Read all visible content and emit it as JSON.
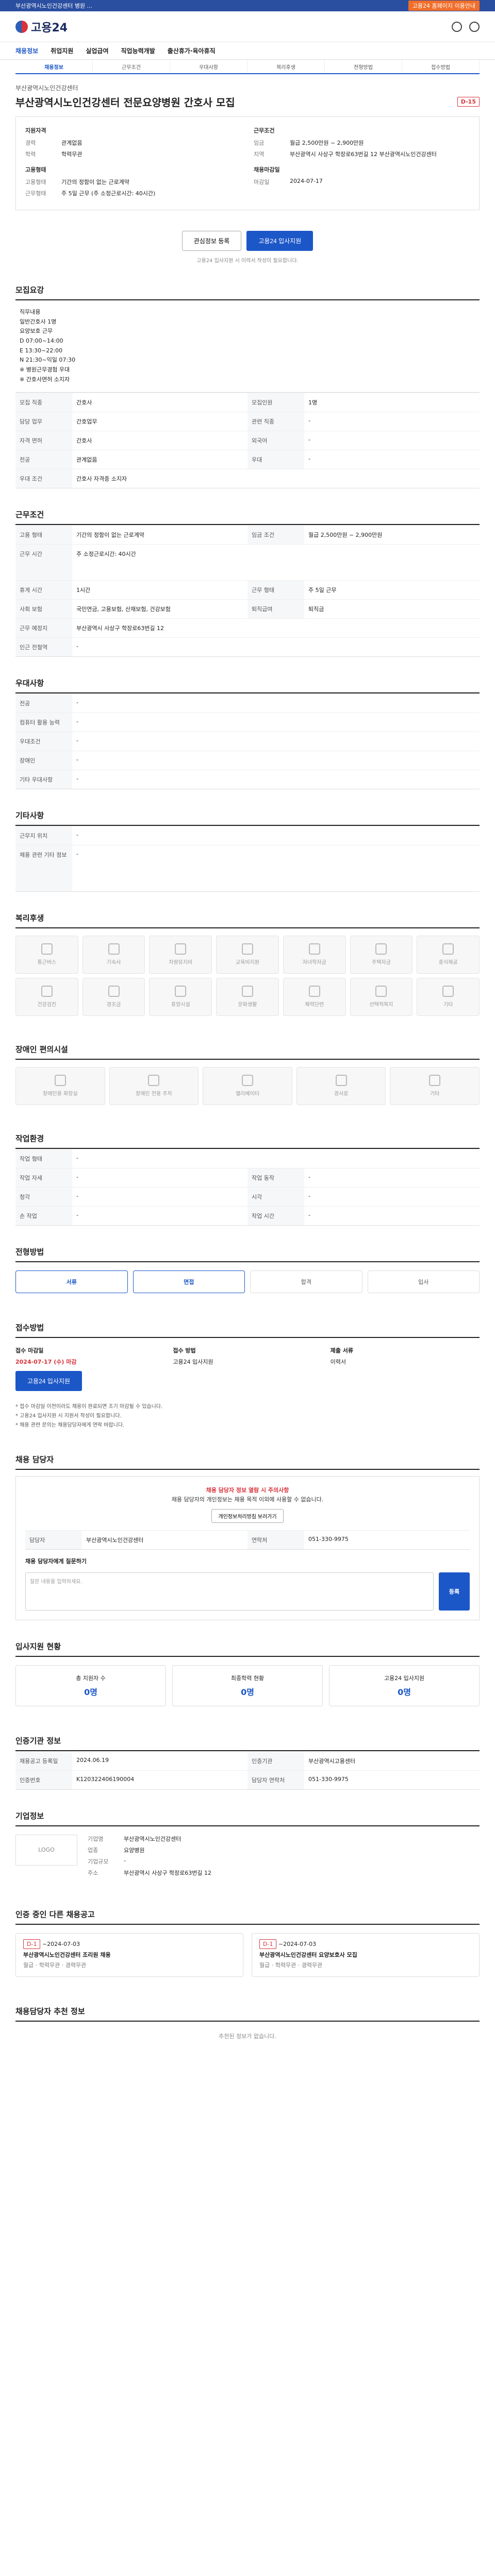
{
  "topbar": {
    "left": "부산광역시노인건강센터 병원 ...",
    "right": "고용24 홈페이지 이용안내"
  },
  "header": {
    "brand": "고용24"
  },
  "gnb": [
    "채용정보",
    "취업지원",
    "실업급여",
    "직업능력개발",
    "출산휴가·육아휴직"
  ],
  "tabs": [
    "채용정보",
    "근무조건",
    "우대사항",
    "복리후생",
    "전형방법",
    "접수방법"
  ],
  "job": {
    "company": "부산광역시노인건강센터",
    "title": "부산광역시노인건강센터 전문요양병원 간호사 모집",
    "dday": "D-15"
  },
  "summary": {
    "left_title": "지원자격",
    "left": [
      {
        "k": "경력",
        "v": "관계없음"
      },
      {
        "k": "학력",
        "v": "학력무관"
      }
    ],
    "left_title2": "고용형태",
    "left2": [
      {
        "k": "고용형태",
        "v": "기간의 정함이 없는 근로계약"
      },
      {
        "k": "근무형태",
        "v": "주 5일 근무 (주 소정근로시간: 40시간)"
      }
    ],
    "right_title": "근무조건",
    "right": [
      {
        "k": "임금",
        "v": "월급 2,500만원 ~ 2,900만원"
      },
      {
        "k": "지역",
        "v": "부산광역시 사상구 학장로63번길 12 부산광역시노인건강센터"
      }
    ],
    "right_title2": "채용마감일",
    "right2": [
      {
        "k": "마감일",
        "v": "2024-07-17"
      }
    ]
  },
  "buttons": {
    "scrap": "관심정보 등록",
    "apply": "고용24 입사지원"
  },
  "note": "고용24 입사지원 시 이력서 작성이 필요합니다.",
  "sec_recruit": {
    "title": "모집요강",
    "desc": "직무내용\n일반간호사 1명\n요양보호 근무\nD 07:00~14:00\nE 13:30~22:00\nN 21:30~익일 07:30\n※ 병원근무경험 우대\n※ 간호사면허 소지자",
    "rows": [
      [
        "모집 직종",
        "간호사",
        "모집인원",
        "1명"
      ],
      [
        "담당 업무",
        "간호업무",
        "관련 직종",
        "-"
      ],
      [
        "자격 면허",
        "간호사",
        "외국어",
        "-"
      ],
      [
        "전공",
        "관계없음",
        "우대",
        "-"
      ],
      [
        "우대 조건",
        "간호사 자격증 소지자",
        "",
        ""
      ]
    ]
  },
  "sec_work": {
    "title": "근무조건",
    "rows": [
      [
        "고용 형태",
        "기간의 정함이 없는 근로계약",
        "임금 조건",
        "월급 2,500만원 ~ 2,900만원"
      ],
      [
        "근무 시간",
        "주 소정근로시간: 40시간",
        "",
        ""
      ],
      [
        "휴게 시간",
        "1시간",
        "근무 형태",
        "주 5일 근무"
      ],
      [
        "사회 보험",
        "국민연금, 고용보험, 산재보험, 건강보험",
        "퇴직급여",
        "퇴직금"
      ],
      [
        "근무 예정지",
        "부산광역시 사상구 학장로63번길 12",
        "",
        ""
      ],
      [
        "인근 전철역",
        "-",
        "",
        ""
      ]
    ]
  },
  "sec_pref": {
    "title": "우대사항",
    "rows": [
      [
        "전공",
        "-"
      ],
      [
        "컴퓨터 활용 능력",
        "-"
      ],
      [
        "우대조건",
        "-"
      ],
      [
        "장애인",
        "-"
      ],
      [
        "기타 우대사항",
        "-"
      ]
    ]
  },
  "sec_etc": {
    "title": "기타사항",
    "rows": [
      [
        "근무지 위치",
        "-"
      ],
      [
        "채용 관련 기타 정보",
        "-"
      ]
    ]
  },
  "sec_welfare": {
    "title": "복리후생",
    "items": [
      "통근버스",
      "기숙사",
      "차량유지비",
      "교육비지원",
      "자녀학자금",
      "주택자금",
      "중식제공",
      "건강검진",
      "경조금",
      "휴양시설",
      "문화생활",
      "체력단련",
      "선택적복지",
      "기타"
    ]
  },
  "sec_disab": {
    "title": "장애인 편의시설",
    "items": [
      "장애인용 화장실",
      "장애인 전용 주차",
      "엘리베이터",
      "경사로",
      "기타"
    ]
  },
  "sec_env": {
    "title": "작업환경",
    "rows": [
      [
        "작업 형태",
        "-",
        "",
        ""
      ],
      [
        "작업 자세",
        "-",
        "작업 동작",
        "-"
      ],
      [
        "청각",
        "-",
        "시각",
        "-"
      ],
      [
        "손 작업",
        "-",
        "작업 시간",
        "-"
      ]
    ]
  },
  "sec_process": {
    "title": "전형방법",
    "steps": [
      "서류",
      "면접",
      "합격",
      "입사"
    ]
  },
  "sec_apply": {
    "title": "접수방법",
    "deadline_label": "접수 마감일",
    "deadline": "2024-07-17 (수) 마감",
    "method_label": "접수 방법",
    "method": "고용24 입사지원",
    "docs_label": "제출 서류",
    "docs": "이력서",
    "apply_btn": "고용24 입사지원",
    "bullets": [
      "* 접수 마감일 이전이라도 채용이 완료되면 조기 마감될 수 있습니다.",
      "* 고용24 입사지원 시 지원서 작성이 필요합니다.",
      "* 채용 관련 문의는 채용담당자에게 연락 바랍니다."
    ]
  },
  "sec_manager": {
    "title": "채용 담당자",
    "alert1": "채용 담당자 정보 열람 시 주의사항",
    "alert2": "채용 담당자의 개인정보는 채용 목적 이외에 사용할 수 없습니다.",
    "alert_btn": "개인정보처리방침 보러가기",
    "company_label": "부산광역시노인건강센터",
    "name": "담당자",
    "phone_label": "연락처",
    "phone": "051-330-9975",
    "qna_title": "채용 담당자에게 질문하기",
    "qna_placeholder": "질문 내용을 입력하세요.",
    "qna_send": "등록"
  },
  "sec_status": {
    "title": "입사지원 현황",
    "items": [
      {
        "label": "총 지원자 수",
        "value": "0명"
      },
      {
        "label": "최종학력 현황",
        "value": "0명"
      },
      {
        "label": "고용24 입사지원",
        "value": "0명"
      }
    ]
  },
  "sec_info": {
    "title": "인증기관 정보",
    "rows": [
      [
        "채용공고 등록일",
        "2024.06.19",
        "인증기관",
        "부산광역시고용센터"
      ],
      [
        "인증번호",
        "K120322406190004",
        "담당자 연락처",
        "051-330-9975"
      ]
    ]
  },
  "sec_corp": {
    "title": "기업정보",
    "logo": "LOGO",
    "name_label": "기업명",
    "name": "부산광역시노인건강센터",
    "ind_label": "업종",
    "ind": "요양병원",
    "size_label": "기업규모",
    "size": "-",
    "addr_label": "주소",
    "addr": "부산광역시 사상구 학장로63번길 12"
  },
  "sec_others": {
    "title": "인증 중인 다른 채용공고",
    "items": [
      {
        "dday": "D-1",
        "date": "~2024-07-03",
        "title": "부산광역시노인건강센터 조리원 채용",
        "info": "월급 · 학력무관 · 경력무관"
      },
      {
        "dday": "D-1",
        "date": "~2024-07-03",
        "title": "부산광역시노인건강센터 요양보호사 모집",
        "info": "월급 · 학력무관 · 경력무관"
      }
    ]
  },
  "sec_recommend": {
    "title": "채용담당자 추천 정보",
    "empty": "추천된 정보가 없습니다."
  }
}
